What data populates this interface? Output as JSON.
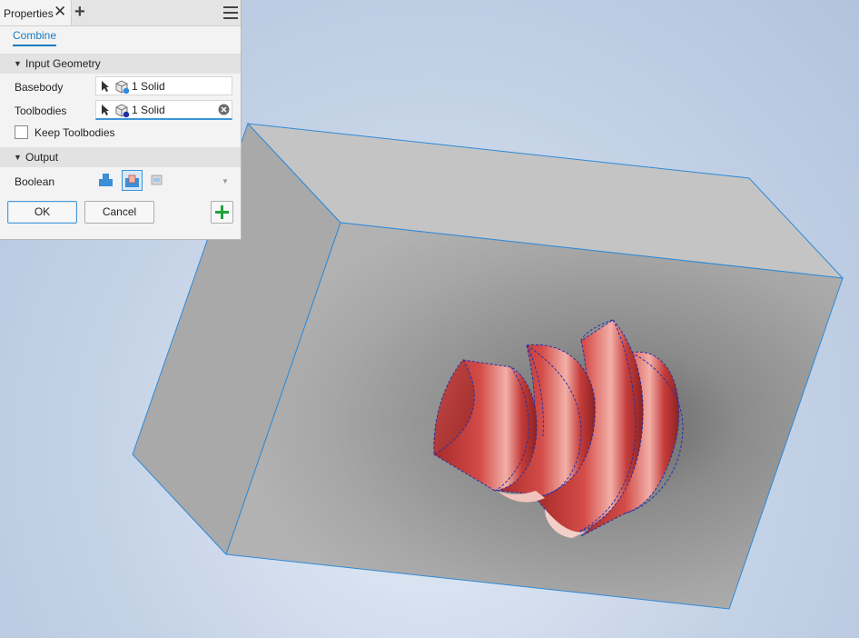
{
  "panel": {
    "tab_label": "Properties",
    "command_tab": "Combine",
    "input_section": "Input Geometry",
    "basebody_label": "Basebody",
    "basebody_value": "1 Solid",
    "toolbodies_label": "Toolbodies",
    "toolbodies_value": "1 Solid",
    "keep_toolbodies_label": "Keep Toolbodies",
    "keep_toolbodies_checked": false,
    "output_section": "Output",
    "boolean_label": "Boolean",
    "boolean_options": [
      "join-icon",
      "cut-icon",
      "intersect-icon"
    ],
    "boolean_selected": "cut-icon",
    "ok_label": "OK",
    "cancel_label": "Cancel",
    "apply_icon": "plus-icon"
  },
  "colors": {
    "accent": "#1a7bc1",
    "box_edge": "#2e8ad8",
    "tool_body": "#c23a3a",
    "apply_green": "#22a33c"
  }
}
